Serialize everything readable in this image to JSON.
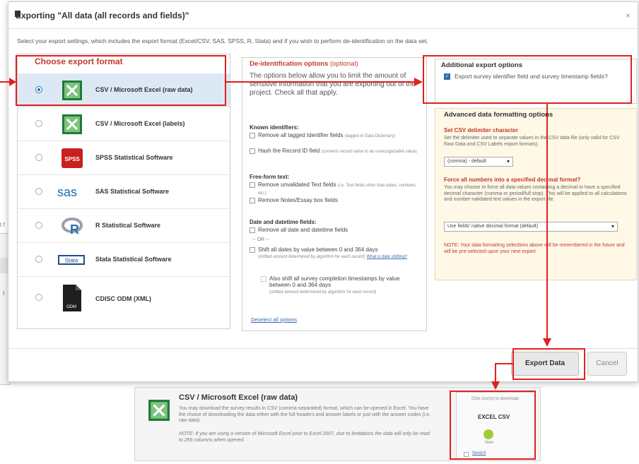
{
  "background": {
    "left_text": "t f",
    "row_label": "I"
  },
  "dialog": {
    "title": "Exporting \"All data (all records and fields)\"",
    "close": "×",
    "description": "Select your export settings, which includes the export format (Excel/CSV, SAS, SPSS, R, Stata) and if you wish to perform de-identification on the data set."
  },
  "formats": {
    "legend": "Choose export format",
    "items": [
      {
        "label": "CSV / Microsoft Excel (raw data)",
        "icon": "excel-icon",
        "selected": true
      },
      {
        "label": "CSV / Microsoft Excel (labels)",
        "icon": "excel-icon",
        "selected": false
      },
      {
        "label": "SPSS Statistical Software",
        "icon": "spss-icon",
        "selected": false
      },
      {
        "label": "SAS Statistical Software",
        "icon": "sas-icon",
        "selected": false
      },
      {
        "label": "R Statistical Software",
        "icon": "r-icon",
        "selected": false
      },
      {
        "label": "Stata Statistical Software",
        "icon": "stata-icon",
        "selected": false
      },
      {
        "label": "CDISC ODM (XML)",
        "icon": "odm-file-icon",
        "selected": false
      }
    ],
    "spss_logo": "SPSS",
    "sas_logo": "sas",
    "stata_logo": "Stata",
    "odm_logo": "ODM"
  },
  "deid": {
    "title": "De-identification options",
    "optional": "(optional)",
    "intro": "The options below allow you to limit the amount of sensitive information that you are exporting out of the project. Check all that apply.",
    "known_heading": "Known identifiers:",
    "known_opt1": "Remove all tagged Identifier fields",
    "known_opt1_note": "(tagged in Data Dictionary)",
    "known_opt2": "Hash the Record ID field",
    "known_opt2_note": "(converts record name to an unrecognizable value)",
    "free_heading": "Free-form text:",
    "free_opt1": "Remove unvalidated Text fields",
    "free_opt1_note": "(i.e. Text fields other than dates, numbers, etc.)",
    "free_opt2": "Remove Notes/Essay box fields",
    "date_heading": "Date and datetime fields:",
    "date_opt1": "Remove all date and datetime fields",
    "or_text": "-- OR --",
    "date_opt2": "Shift all dates by value between 0 and 364 days",
    "date_opt2_note": "(shifted amount determined by algorithm for each record)",
    "date_opt2_link": "What is date shifting?",
    "date_opt3": "Also shift all survey completion timestamps by value between 0 and 364 days",
    "date_opt3_note": "(shifted amount determined by algorithm for each record)",
    "deselect": "Deselect all options"
  },
  "additional": {
    "title": "Additional export options",
    "option": "Export survey identifier field and survey timestamp fields?",
    "checked": "✓"
  },
  "advanced": {
    "title": "Advanced data formatting options",
    "delim_heading": "Set CSV delimiter character",
    "delim_text": "Set the delimiter used to separate values in the CSV data file (only valid for CSV Raw Data and CSV Labels export formats).",
    "delim_value": "(comma) - default",
    "decimal_heading": "Force all numbers into a specified decimal format?",
    "decimal_text": "You may choose to force all data values containing a decimal to have a specified decimal character (comma or period/full stop). This will be applied to all calculations and number-validated text values in the export file.",
    "decimal_value": "Use fields' native decimal format (default)",
    "note": "NOTE: Your data formatting selections above will be remembered in the future and will be pre-selected upon your next export."
  },
  "footer": {
    "export_label": "Export Data",
    "cancel_label": "Cancel"
  },
  "result": {
    "title": "CSV / Microsoft Excel (raw data)",
    "text": "You may download the survey results in CSV (comma-separated) format, which can be opened in Excel. You have the choice of downloading the data either with the full headers and answer labels or just with the answer codes (i.e. raw data).",
    "note": "NOTE: If you are using a version of Microsoft Excel prior to Excel 2007, due to limitations the data will only be read to 256 columns when opened.",
    "download_hint": "Click icon(s) to download:",
    "file_label": "EXCEL CSV",
    "new_label": "New",
    "send_it": "Send-It"
  }
}
